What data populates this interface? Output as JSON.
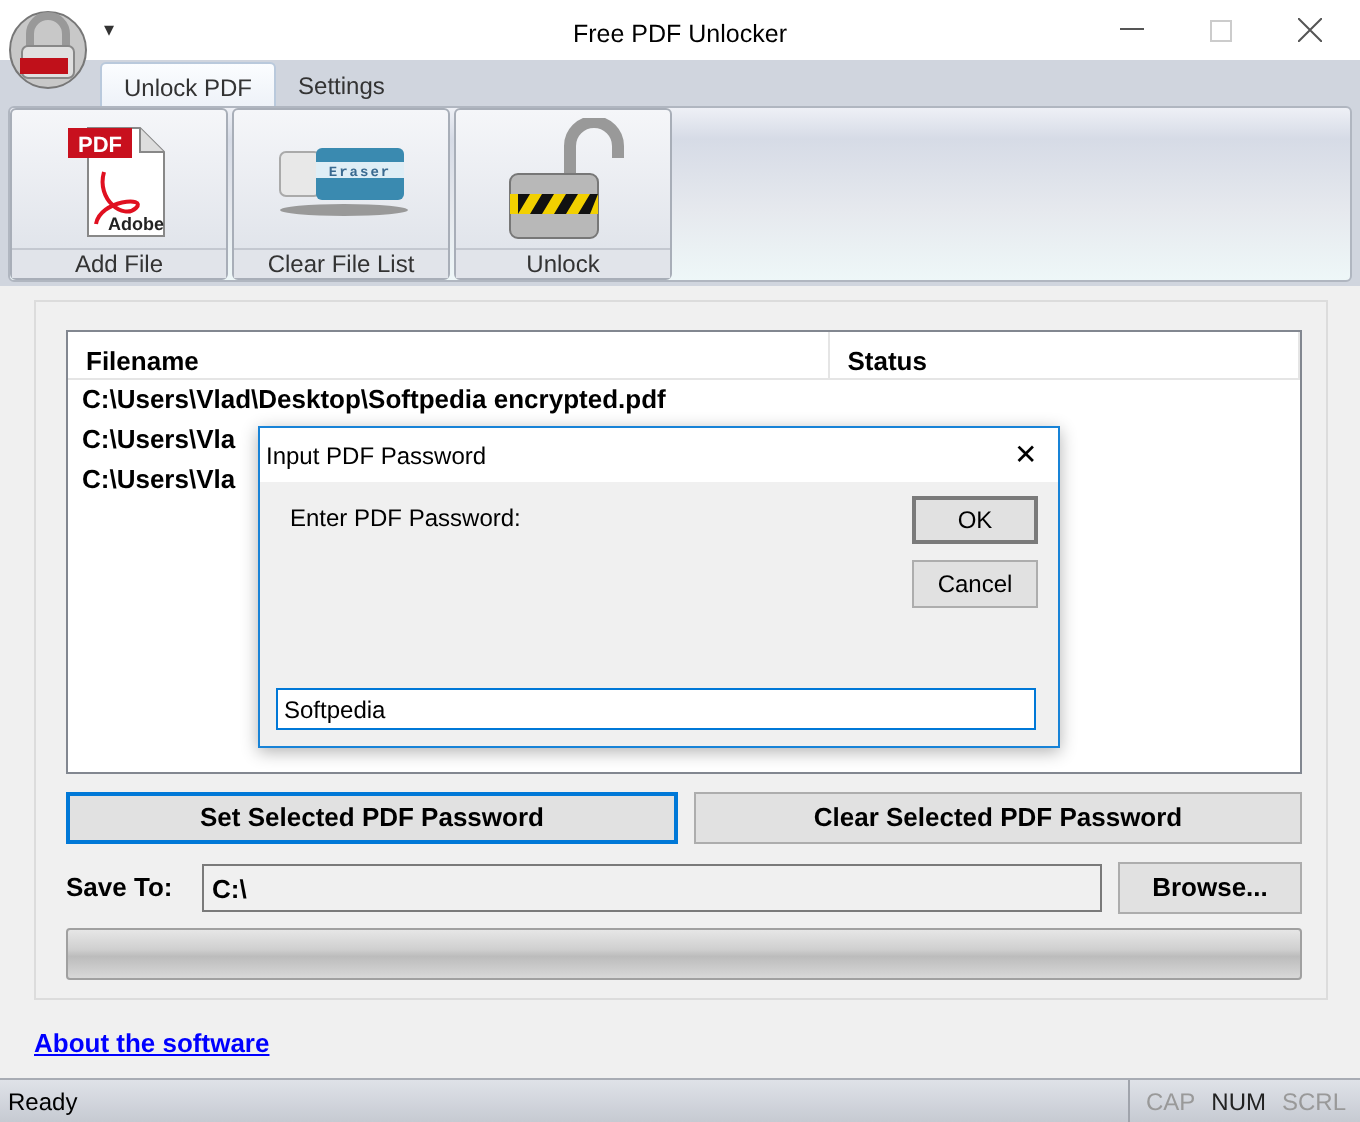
{
  "window": {
    "title": "Free PDF Unlocker",
    "quick_access": "▾"
  },
  "tabs": [
    {
      "label": "Unlock PDF",
      "selected": true
    },
    {
      "label": "Settings",
      "selected": false
    }
  ],
  "ribbon": [
    {
      "label": "Add File",
      "kind": "pdf"
    },
    {
      "label": "Clear File List",
      "kind": "eraser"
    },
    {
      "label": "Unlock",
      "kind": "lock"
    }
  ],
  "eraser_label": "Eraser",
  "pdf_icon_texts": [
    "PDF",
    "Adobe"
  ],
  "table": {
    "columns": [
      "Filename",
      "Status"
    ],
    "rows": [
      {
        "filename": "C:\\Users\\Vlad\\Desktop\\Softpedia encrypted.pdf"
      },
      {
        "filename": "C:\\Users\\Vla"
      },
      {
        "filename": "C:\\Users\\Vla"
      }
    ]
  },
  "actions": [
    {
      "label": "Set Selected PDF Password",
      "focused": true
    },
    {
      "label": "Clear Selected PDF Password",
      "focused": false
    }
  ],
  "save_to": {
    "label": "Save To:",
    "value": "C:\\",
    "button": "Browse..."
  },
  "progress": {
    "level": 0
  },
  "link": "About the software",
  "status_bar": {
    "text": "Ready",
    "indicators": [
      {
        "label": "CAP",
        "on": false
      },
      {
        "label": "NUM",
        "on": true
      },
      {
        "label": "SCRL",
        "on": false
      }
    ]
  },
  "dialog": {
    "title": "Input PDF Password",
    "close": "✕",
    "prompt": "Enter PDF Password:",
    "value": "Softpedia",
    "buttons": [
      {
        "label": "OK",
        "default": true
      },
      {
        "label": "Cancel",
        "default": false
      }
    ]
  }
}
